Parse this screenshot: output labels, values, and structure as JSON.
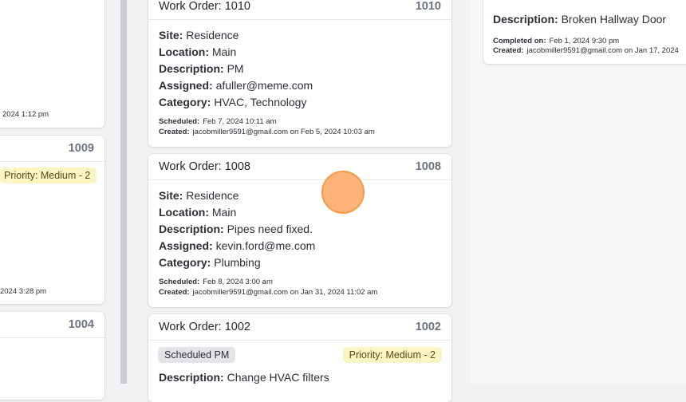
{
  "left_column": {
    "card_a": {
      "meta_tail": "2024 1:12 pm"
    },
    "card_b": {
      "number": "1009",
      "priority": "Priority: Medium - 2",
      "meta_tail": "2024 3:28 pm"
    },
    "card_c": {
      "number": "1004"
    }
  },
  "middle_column": {
    "cards": [
      {
        "title": "Work Order: 1010",
        "number": "1010",
        "fields": [
          {
            "label": "Site:",
            "value": "Residence"
          },
          {
            "label": "Location:",
            "value": "Main"
          },
          {
            "label": "Description:",
            "value": "PM"
          },
          {
            "label": "Assigned:",
            "value": "afuller@meme.com"
          },
          {
            "label": "Category:",
            "value": "HVAC, Technology"
          }
        ],
        "scheduled_label": "Scheduled:",
        "scheduled_value": "Feb 7, 2024 10:11 am",
        "created_label": "Created:",
        "created_value": "jacobmiller9591@gmail.com on Feb 5, 2024 10:03 am"
      },
      {
        "title": "Work Order: 1008",
        "number": "1008",
        "fields": [
          {
            "label": "Site:",
            "value": "Residence"
          },
          {
            "label": "Location:",
            "value": "Main"
          },
          {
            "label": "Description:",
            "value": "Pipes need fixed."
          },
          {
            "label": "Assigned:",
            "value": "kevin.ford@me.com"
          },
          {
            "label": "Category:",
            "value": "Plumbing"
          }
        ],
        "scheduled_label": "Scheduled:",
        "scheduled_value": "Feb 8, 2024 3:00 am",
        "created_label": "Created:",
        "created_value": "jacobmiller9591@gmail.com on Jan 31, 2024 11:02 am"
      },
      {
        "title": "Work Order: 1002",
        "number": "1002",
        "type_badge": "Scheduled PM",
        "priority": "Priority: Medium - 2",
        "description_label": "Description:",
        "description_value": "Change HVAC filters"
      }
    ]
  },
  "right_column": {
    "card": {
      "description_label": "Description:",
      "description_value": "Broken Hallway Door",
      "completed_label": "Completed on:",
      "completed_value": "Feb 1, 2024 9:30 pm",
      "created_label": "Created:",
      "created_value": "jacobmiller9591@gmail.com on Jan 17, 2024"
    }
  },
  "colors": {
    "priority_badge_bg": "#fbf5c4",
    "type_badge_bg": "#e3e4e7",
    "cursor": "#ffa866"
  }
}
